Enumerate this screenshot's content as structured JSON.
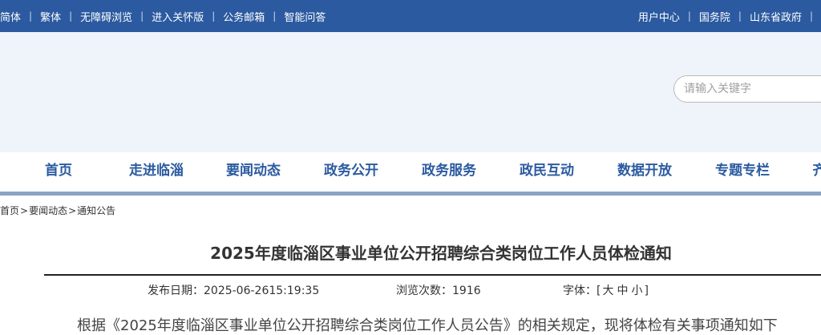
{
  "topbar": {
    "left_links": [
      "简体",
      "繁体",
      "无障碍浏览",
      "进入关怀版",
      "公务邮箱",
      "智能问答"
    ],
    "separator": "|",
    "right_links": [
      "用户中心",
      "国务院",
      "山东省政府"
    ]
  },
  "search": {
    "placeholder": "请输入关键字",
    "value": ""
  },
  "nav": {
    "items": [
      "首页",
      "走进临淄",
      "要闻动态",
      "政务公开",
      "政务服务",
      "政民互动",
      "数据开放",
      "专题专栏",
      "齐"
    ]
  },
  "breadcrumb": {
    "items": [
      "首页",
      "要闻动态",
      "通知公告"
    ],
    "separator": ">"
  },
  "article": {
    "title": "2025年度临淄区事业单位公开招聘综合类岗位工作人员体检通知",
    "meta": {
      "date_label": "发布日期：",
      "date_value": "2025-06-2615:19:35",
      "views_label": "浏览次数：",
      "views_value": "1916",
      "font_label": "字体：",
      "font_open": "[",
      "font_sizes": [
        "大",
        "中",
        "小"
      ],
      "font_close": "]"
    },
    "body_peek": "根据《2025年度临淄区事业单位公开招聘综合类岗位工作人员公告》的相关规定，现将体检有关事项通知如下"
  },
  "colors": {
    "brand_blue": "#2b5aa0",
    "banner_bg": "#eff3fa",
    "nav_rule": "#8aa2c6"
  }
}
